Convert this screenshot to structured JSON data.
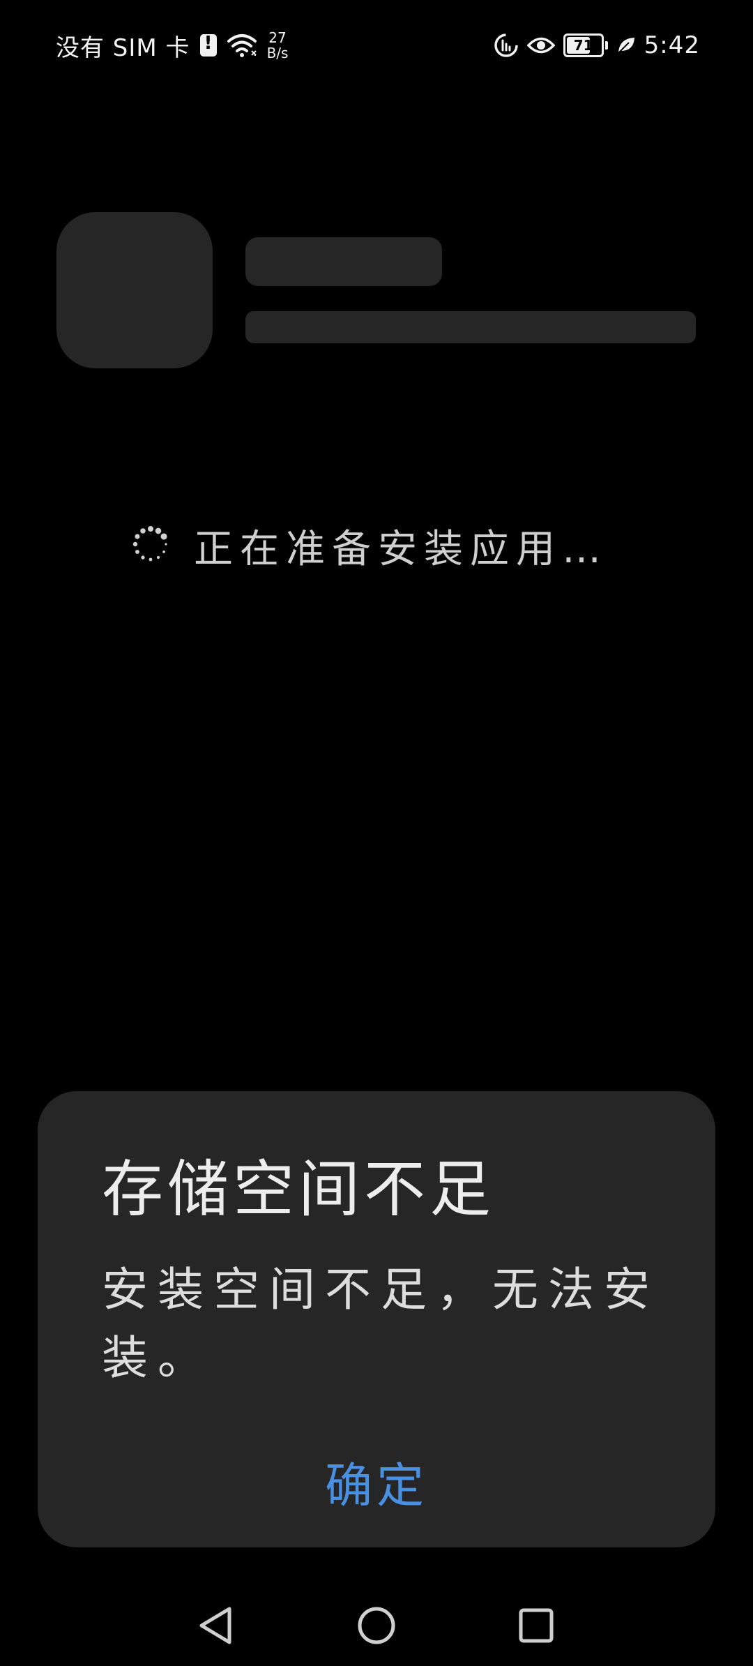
{
  "status_bar": {
    "carrier": "没有 SIM 卡",
    "net_speed_value": "27",
    "net_speed_unit": "B/s",
    "battery_level": "71",
    "time": "5:42",
    "icons": [
      "alert-icon",
      "wifi-icon",
      "data-saver-icon",
      "eye-comfort-icon",
      "battery-icon",
      "leaf-icon"
    ]
  },
  "installer": {
    "loading_text": "正在准备安装应用…"
  },
  "dialog": {
    "title": "存储空间不足",
    "message": "安装空间不足，无法安装。",
    "confirm_label": "确定",
    "accent_color": "#4a90e2"
  },
  "nav_bar": {
    "icons": [
      "back-icon",
      "home-icon",
      "recents-icon"
    ]
  }
}
